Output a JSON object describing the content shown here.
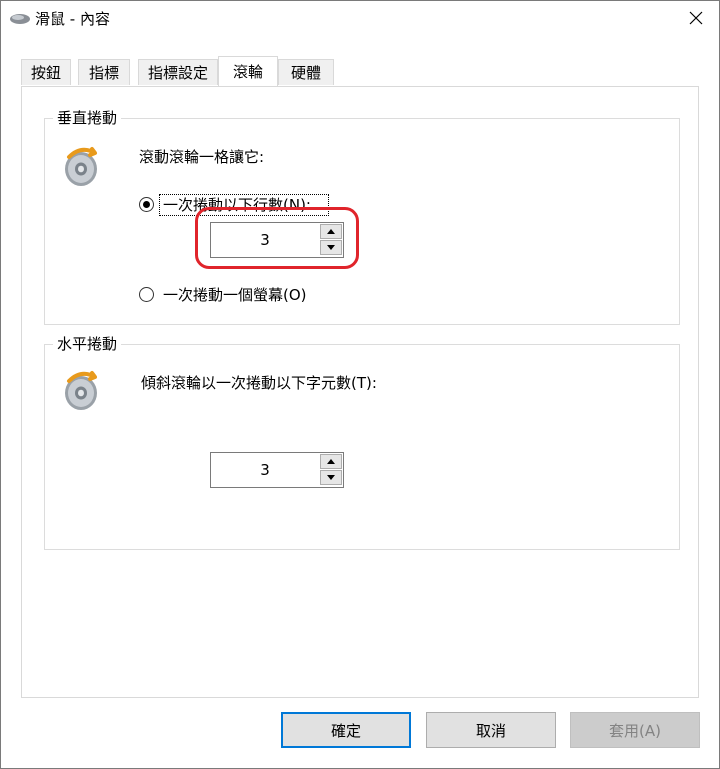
{
  "window": {
    "title": "滑鼠 - 內容",
    "icons": {
      "app": "mouse-icon",
      "close": "close-icon"
    }
  },
  "tabs": [
    {
      "label": "按鈕",
      "active": false
    },
    {
      "label": "指標",
      "active": false
    },
    {
      "label": "指標設定",
      "active": false
    },
    {
      "label": "滾輪",
      "active": true
    },
    {
      "label": "硬體",
      "active": false
    }
  ],
  "vertical": {
    "group_label": "垂直捲動",
    "prompt": "滾動滾輪一格讓它:",
    "option_lines": {
      "label": "一次捲動以下行數(N):",
      "selected": true
    },
    "lines_value": "3",
    "option_screen": {
      "label": "一次捲動一個螢幕(O)",
      "selected": false
    }
  },
  "horizontal": {
    "group_label": "水平捲動",
    "prompt": "傾斜滾輪以一次捲動以下字元數(T):",
    "chars_value": "3"
  },
  "buttons": {
    "ok": "確定",
    "cancel": "取消",
    "apply": "套用(A)"
  },
  "colors": {
    "highlight": "#e0242b",
    "default_button_border": "#0078d7"
  }
}
